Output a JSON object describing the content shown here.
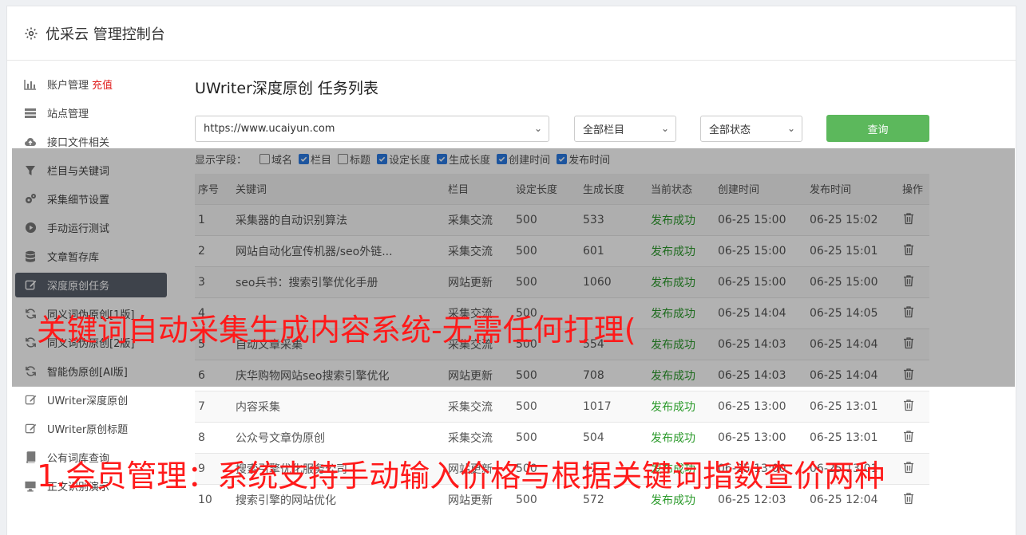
{
  "header": {
    "title": "优采云 管理控制台",
    "icon": "gear-icon"
  },
  "sidebar": {
    "items": [
      {
        "label": "账户管理",
        "extra": "充值",
        "icon": "bar-chart-icon"
      },
      {
        "label": "站点管理",
        "icon": "server-icon"
      },
      {
        "label": "接口文件相关",
        "icon": "cloud-upload-icon"
      },
      {
        "label": "栏目与关键词",
        "icon": "filter-icon"
      },
      {
        "label": "采集细节设置",
        "icon": "cogs-icon"
      },
      {
        "label": "手动运行测试",
        "icon": "play-circle-icon"
      },
      {
        "label": "文章暂存库",
        "icon": "database-icon"
      },
      {
        "label": "深度原创任务",
        "icon": "edit-icon",
        "active": true
      },
      {
        "label": "同义词伪原创[1版]",
        "icon": "refresh-icon"
      },
      {
        "label": "同义词伪原创[2版]",
        "icon": "refresh-icon"
      },
      {
        "label": "智能伪原创[AI版]",
        "icon": "refresh-icon"
      },
      {
        "label": "UWriter深度原创",
        "icon": "edit-icon"
      },
      {
        "label": "UWriter原创标题",
        "icon": "edit-icon"
      },
      {
        "label": "公有词库查询",
        "icon": "book-icon"
      },
      {
        "label": "正文识别演示",
        "icon": "monitor-icon"
      }
    ]
  },
  "main": {
    "title": "UWriter深度原创 任务列表",
    "site_select": "https://www.ucaiyun.com",
    "column_select": "全部栏目",
    "status_select": "全部状态",
    "query_label": "查询",
    "fields_label": "显示字段：",
    "fields": [
      {
        "label": "域名",
        "checked": false
      },
      {
        "label": "栏目",
        "checked": true
      },
      {
        "label": "标题",
        "checked": false
      },
      {
        "label": "设定长度",
        "checked": true
      },
      {
        "label": "生成长度",
        "checked": true
      },
      {
        "label": "创建时间",
        "checked": true
      },
      {
        "label": "发布时间",
        "checked": true
      }
    ],
    "columns": [
      "序号",
      "关键词",
      "栏目",
      "设定长度",
      "生成长度",
      "当前状态",
      "创建时间",
      "发布时间",
      "操作"
    ],
    "rows": [
      [
        "1",
        "采集器的自动识别算法",
        "采集交流",
        "500",
        "533",
        "发布成功",
        "06-25 15:00",
        "06-25 15:02"
      ],
      [
        "2",
        "网站自动化宣传机器/seo外链...",
        "采集交流",
        "500",
        "601",
        "发布成功",
        "06-25 15:00",
        "06-25 15:01"
      ],
      [
        "3",
        "seo兵书：搜索引擎优化手册",
        "网站更新",
        "500",
        "1060",
        "发布成功",
        "06-25 15:00",
        "06-25 15:00"
      ],
      [
        "4",
        "",
        "采集交流",
        "500",
        "",
        "发布成功",
        "06-25 14:04",
        "06-25 14:05"
      ],
      [
        "5",
        "自动文章采集",
        "采集交流",
        "500",
        "554",
        "发布成功",
        "06-25 14:03",
        "06-25 14:04"
      ],
      [
        "6",
        "庆华购物网站seo搜索引擎优化",
        "网站更新",
        "500",
        "708",
        "发布成功",
        "06-25 14:03",
        "06-25 14:04"
      ],
      [
        "7",
        "内容采集",
        "采集交流",
        "500",
        "1017",
        "发布成功",
        "06-25 13:00",
        "06-25 13:01"
      ],
      [
        "8",
        "公众号文章伪原创",
        "采集交流",
        "500",
        "504",
        "发布成功",
        "06-25 13:00",
        "06-25 13:01"
      ],
      [
        "9",
        "搜索引擎优化服务公司",
        "网站更新",
        "500",
        "47",
        "发布成功",
        "06-25 13:00",
        "06-25 13:01"
      ],
      [
        "10",
        "搜索引擎的网站优化",
        "网站更新",
        "500",
        "572",
        "发布成功",
        "06-25 12:03",
        "06-25 12:04"
      ]
    ]
  },
  "overlay": {
    "line1": "关键词自动采集生成内容系统-无需任何打理(",
    "line2": "1.会员管理：系统支持手动输入价格与根据关键词指数查价两种"
  },
  "colors": {
    "accent_green": "#5cb85c",
    "status_green": "#2b9a2b",
    "overlay_red": "#ff1a1a",
    "active_nav": "#59606c"
  }
}
